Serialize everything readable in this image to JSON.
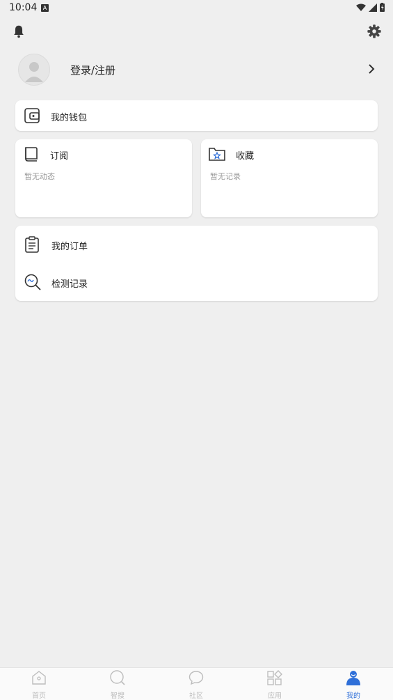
{
  "status": {
    "time": "10:04",
    "badge": "A"
  },
  "profile": {
    "login_label": "登录/注册"
  },
  "wallet": {
    "label": "我的钱包"
  },
  "subscribe": {
    "title": "订阅",
    "empty": "暂无动态"
  },
  "favorites": {
    "title": "收藏",
    "empty": "暂无记录"
  },
  "menu": {
    "orders_label": "我的订单",
    "records_label": "检测记录"
  },
  "tabs": [
    {
      "label": "首页",
      "icon": "home-icon",
      "active": false
    },
    {
      "label": "智搜",
      "icon": "search-icon",
      "active": false
    },
    {
      "label": "社区",
      "icon": "chat-icon",
      "active": false
    },
    {
      "label": "应用",
      "icon": "apps-icon",
      "active": false
    },
    {
      "label": "我的",
      "icon": "user-icon",
      "active": true
    }
  ],
  "colors": {
    "accent": "#2f6fd8",
    "background": "#efefef",
    "inactive": "#bdbdbd"
  }
}
